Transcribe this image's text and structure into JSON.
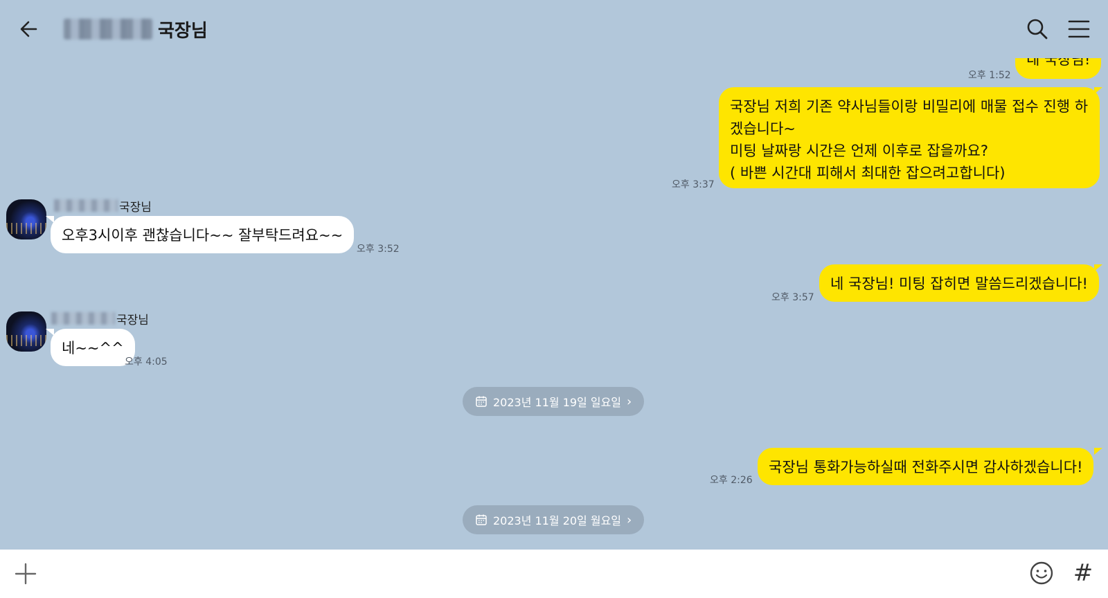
{
  "header": {
    "title": "국장님"
  },
  "messages": {
    "m1": {
      "text": "네 국장님!",
      "time": "오후 1:52"
    },
    "m2": {
      "lines": [
        "국장님 저희 기존 약사님들이랑 비밀리에 매물 접수 진행 하",
        "겠습니다~",
        "미팅 날짜랑 시간은 언제 이후로 잡을까요?",
        "( 바쁜 시간대 피해서 최대한 잡으려고합니다)"
      ],
      "time": "오후 3:37"
    },
    "m3": {
      "sender": "국장님",
      "text": "오후3시이후 괜찮습니다~~ 잘부탁드려요~~",
      "time": "오후 3:52"
    },
    "m4": {
      "text": "네 국장님! 미팅 잡히면 말씀드리겠습니다!",
      "time": "오후 3:57"
    },
    "m5": {
      "sender": "국장님",
      "text": "네~~^^",
      "time": "오후 4:05"
    },
    "m6": {
      "text": "국장님 통화가능하실때 전화주시면 감사하겠습니다!",
      "time": "오후 2:26"
    }
  },
  "dates": {
    "d1": "2023년 11월 19일 일요일",
    "d2": "2023년 11월 20일 월요일"
  },
  "icons": {
    "back": "arrow-left-icon",
    "search": "search-icon",
    "menu": "menu-icon",
    "plus": "plus-icon",
    "emoji": "emoji-icon",
    "hash": "hash-icon"
  },
  "footer": {
    "hash_symbol": "#"
  },
  "colors": {
    "background": "#b2c7da",
    "my_bubble": "#fee500",
    "their_bubble": "#ffffff",
    "date_pill": "#9aacbd"
  }
}
